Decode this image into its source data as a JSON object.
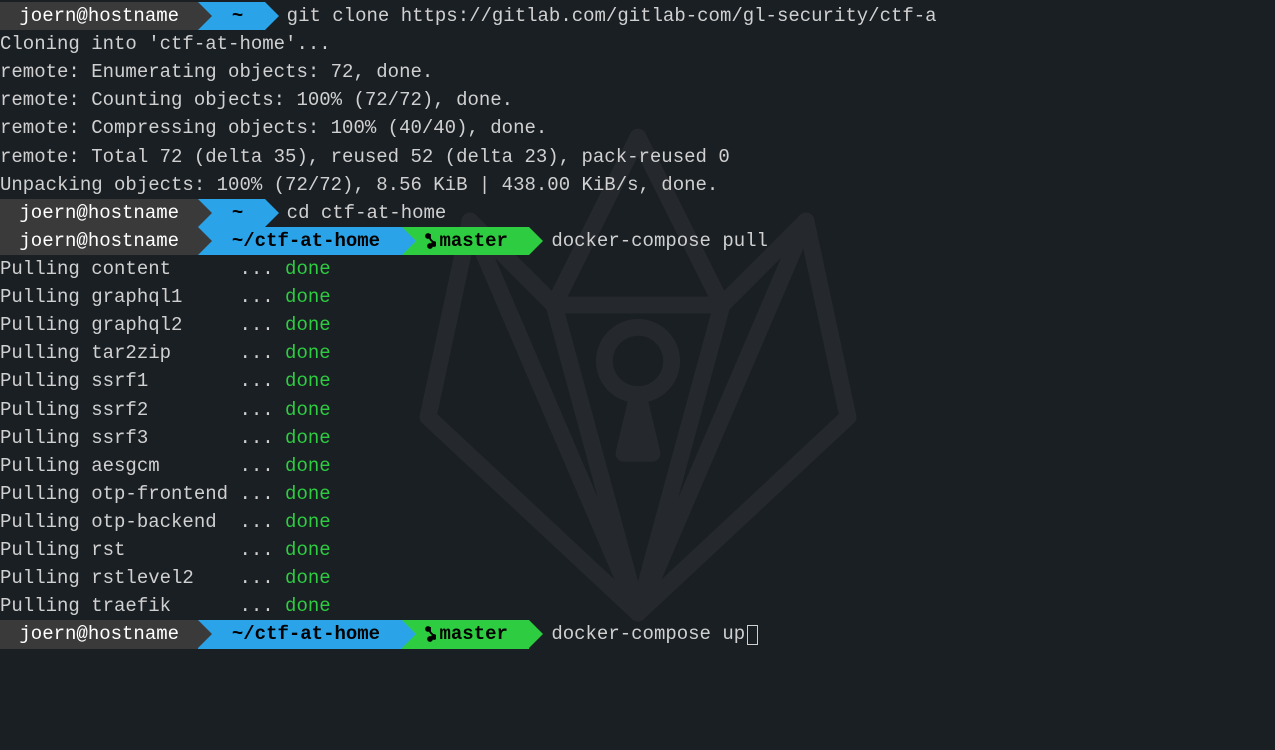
{
  "prompts": {
    "user": "joern@hostname",
    "home_path": "~",
    "repo_path": "~/ctf-at-home",
    "branch": "master"
  },
  "commands": {
    "clone": "git clone https://gitlab.com/gitlab-com/gl-security/ctf-a",
    "cd": "cd ctf-at-home",
    "pull": "docker-compose pull",
    "up": "docker-compose up"
  },
  "clone_output": [
    "Cloning into 'ctf-at-home'...",
    "remote: Enumerating objects: 72, done.",
    "remote: Counting objects: 100% (72/72), done.",
    "remote: Compressing objects: 100% (40/40), done.",
    "remote: Total 72 (delta 35), reused 52 (delta 23), pack-reused 0",
    "Unpacking objects: 100% (72/72), 8.56 KiB | 438.00 KiB/s, done."
  ],
  "pull_services": [
    "content",
    "graphql1",
    "graphql2",
    "tar2zip",
    "ssrf1",
    "ssrf2",
    "ssrf3",
    "aesgcm",
    "otp-frontend",
    "otp-backend",
    "rst",
    "rstlevel2",
    "traefik"
  ],
  "pull_status": "done",
  "pull_prefix": "Pulling "
}
